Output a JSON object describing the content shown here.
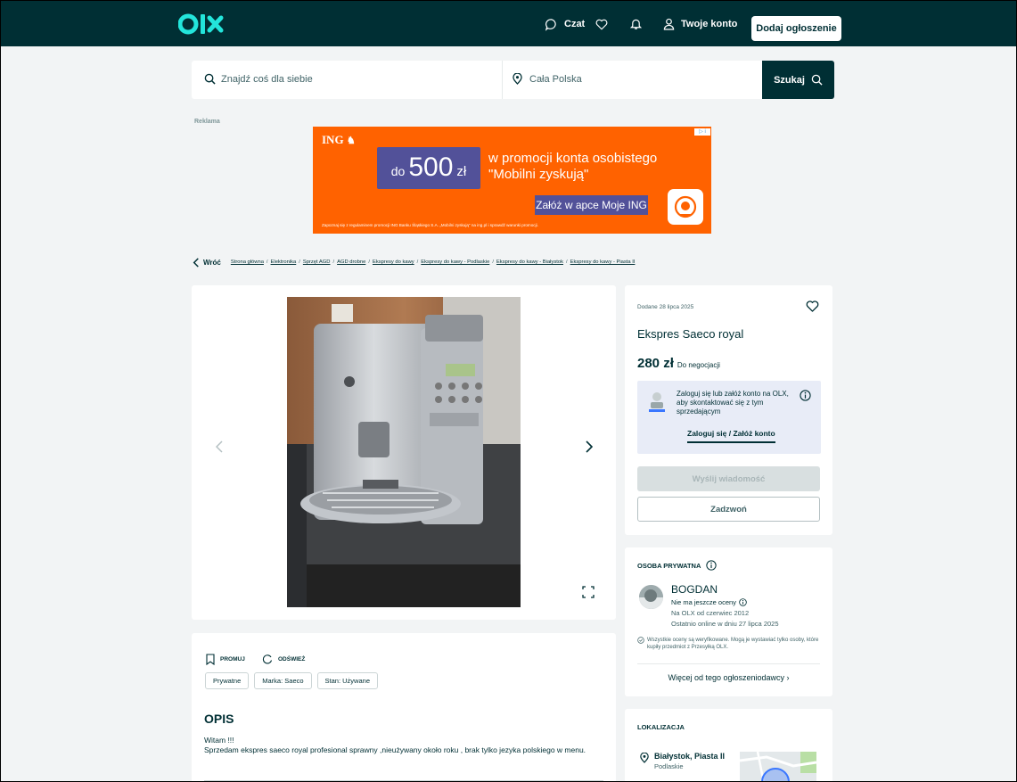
{
  "header": {
    "logo_text": "OLX",
    "chat_label": "Czat",
    "account_label": "Twoje konto",
    "add_listing_label": "Dodaj ogłoszenie"
  },
  "search": {
    "query_placeholder": "Znajdź coś dla siebie",
    "location_value": "Cała Polska",
    "button_label": "Szukaj"
  },
  "advertisement": {
    "label": "Reklama",
    "brand": "ING",
    "amount_prefix": "do",
    "amount": "500",
    "amount_currency": "zł",
    "headline": "w promocji konta osobistego\n\"Mobilni zyskują\"",
    "cta": "Załóż w apce Moje ING",
    "legal": "Zapoznaj się z regulaminem promocji ING Banku Śląskiego S.A. „Mobilni zyskują\" na ing.pl i sprawdź warunki promocji."
  },
  "breadcrumbs": {
    "back_label": "Wróć",
    "items": [
      "Strona główna",
      "Elektronika",
      "Sprzęt AGD",
      "AGD drobne",
      "Ekspresy do kawy",
      "Ekspresy do kawy - Podlaskie",
      "Ekspresy do kawy - Białystok",
      "Ekspresy do kawy - Piasta II"
    ]
  },
  "listing": {
    "added_date": "Dodane 28 lipca 2025",
    "title": "Ekspres Saeco royal",
    "price": "280 zł",
    "negotiable": "Do negocjacji",
    "login_prompt": "Zaloguj się lub załóż konto na OLX, aby skontaktować się z tym sprzedającym",
    "login_link": "Zaloguj się / Załóż konto",
    "send_message": "Wyślij wiadomość",
    "call": "Zadzwoń"
  },
  "seller": {
    "section_title": "OSOBA PRYWATNA",
    "name": "BOGDAN",
    "rating": "Nie ma jeszcze oceny",
    "member_since": "Na OLX od czerwiec 2012",
    "last_online": "Ostatnio online w dniu 27 lipca 2025",
    "verified_note": "Wszystkie oceny są weryfikowane. Mogą je wystawiać tylko osoby, które kupiły przedmiot z Przesyłką OLX.",
    "more_listings": "Więcej od tego ogłoszeniodawcy"
  },
  "location": {
    "section_title": "LOKALIZACJA",
    "city": "Białystok, Piasta II",
    "region": "Podlaskie"
  },
  "description": {
    "promote_label": "PROMUJ",
    "refresh_label": "ODŚWIEŻ",
    "tags": [
      "Prywatne",
      "Marka: Saeco",
      "Stan: Używane"
    ],
    "heading": "OPIS",
    "greeting": "Witam !!!",
    "body": "Sprzedam ekspres saeco royal profesional sprawny ,nieużywany około roku , brak tylko jezyka polskiego w menu."
  },
  "colors": {
    "brand_dark": "#002f34",
    "olx_teal": "#23e5db",
    "ad_orange": "#ff6200",
    "ad_purple": "#525199",
    "login_box": "#e8ecf7",
    "page_bg": "#f2f4f5"
  },
  "icons": {
    "chat": "chat-bubble-icon",
    "favorites": "heart-icon",
    "notifications": "bell-icon",
    "account": "user-icon",
    "search": "search-icon",
    "location": "location-pin-icon",
    "back": "chevron-left-icon",
    "gallery_prev": "chevron-left-icon",
    "gallery_next": "chevron-right-icon",
    "fullscreen": "expand-icon",
    "info": "info-icon",
    "promote": "bookmark-icon",
    "refresh": "refresh-icon",
    "verified": "check-circle-icon"
  }
}
